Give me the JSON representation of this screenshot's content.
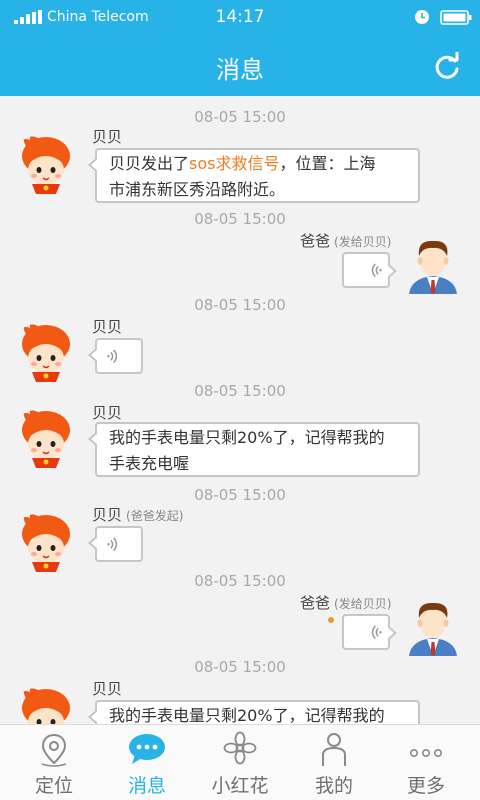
{
  "status_bar": {
    "carrier": "China Telecom",
    "time": "14:17"
  },
  "header": {
    "title": "消息",
    "refresh_icon": "refresh-icon"
  },
  "messages": [
    {
      "time": "08-05  15:00",
      "sender": "贝贝",
      "line1_prefix": "贝贝发出了",
      "line1_highlight": "sos求救信号",
      "line1_suffix": "，位置：上海",
      "line2": "市浦东新区秀沿路附近。"
    },
    {
      "time": "08-05  15:00",
      "sender": "爸爸",
      "note": "(发给贝贝)",
      "type": "voice"
    },
    {
      "time": "08-05  15:00",
      "sender": "贝贝",
      "type": "voice"
    },
    {
      "time": "08-05  15:00",
      "sender": "贝贝",
      "line1": "我的手表电量只剩20%了，记得帮我的",
      "line2": "手表充电喔"
    },
    {
      "time": "08-05  15:00",
      "sender": "贝贝",
      "note": "(爸爸发起)",
      "type": "voice"
    },
    {
      "time": "08-05  15:00",
      "sender": "爸爸",
      "note": "(发给贝贝)",
      "type": "voice",
      "unread": true
    },
    {
      "time": "08-05  15:00",
      "sender": "贝贝",
      "line1": "我的手表电量只剩20%了，记得帮我的"
    }
  ],
  "tabs": [
    {
      "label": "定位",
      "icon": "location-icon"
    },
    {
      "label": "消息",
      "icon": "chat-bubble-icon",
      "active": true
    },
    {
      "label": "小红花",
      "icon": "flower-icon"
    },
    {
      "label": "我的",
      "icon": "person-icon"
    },
    {
      "label": "更多",
      "icon": "more-dots-icon"
    }
  ],
  "colors": {
    "primary": "#27b3e8",
    "highlight": "#f07c1e",
    "unread_dot": "#f09a28",
    "bubble_border": "#c6c6c6"
  }
}
